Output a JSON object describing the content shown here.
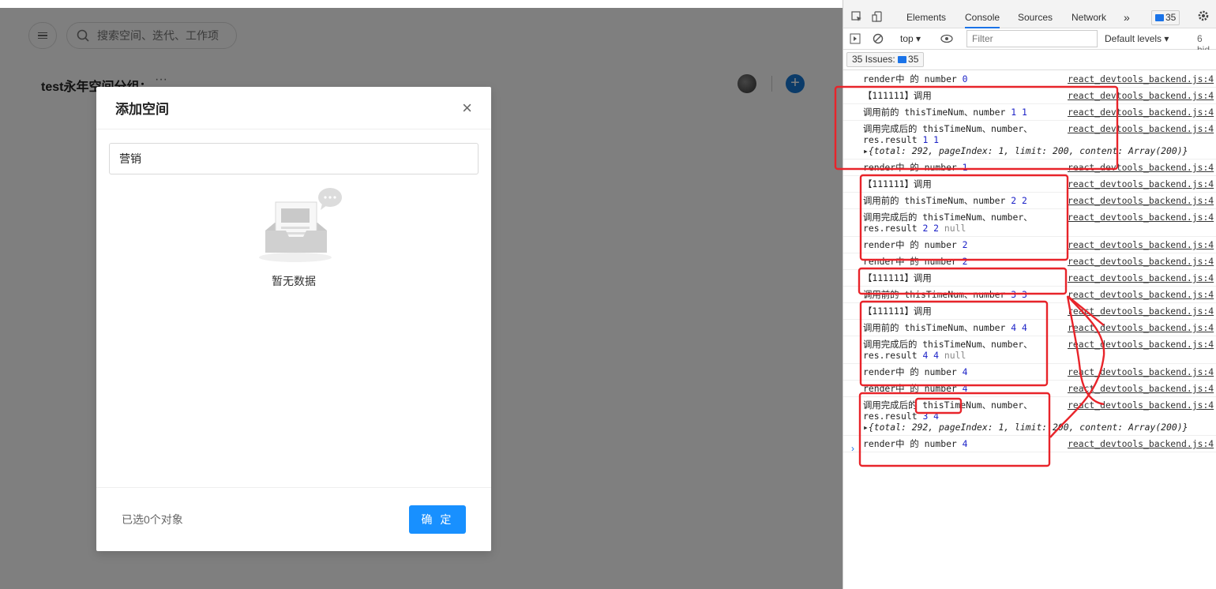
{
  "app": {
    "search_placeholder": "搜索空间、迭代、工作项",
    "space_group_title": "test永年空间分组",
    "more_label": "···"
  },
  "modal": {
    "title": "添加空间",
    "close_glyph": "×",
    "search_value": "营销",
    "empty_text": "暂无数据",
    "selected_count": "已选0个对象",
    "confirm_label": "确 定"
  },
  "devtools": {
    "tabs": [
      "Elements",
      "Console",
      "Sources",
      "Network"
    ],
    "active_tab": "Console",
    "more_tabs": "»",
    "issue_badge_count": "35",
    "context": "top ▾",
    "filter_placeholder": "Filter",
    "levels": "Default levels ▾",
    "hidden": "6 hid",
    "issues_label": "35 Issues:",
    "issues_count": "35",
    "logs": [
      {
        "msg": "render中 的 number ",
        "nums": "0",
        "src": "react_devtools_backend.js:4"
      },
      {
        "msg": "【111111】调用",
        "nums": "",
        "src": "react_devtools_backend.js:4"
      },
      {
        "msg": "调用前的 thisTimeNum、number ",
        "nums": "1 1",
        "src": "react_devtools_backend.js:4"
      },
      {
        "msg": "调用完成后的 thisTimeNum、number、\nres.result ",
        "nums": "1 1",
        "src": "react_devtools_backend.js:4",
        "obj": "{total: 292, pageIndex: 1, limit: 200, content: Array(200)}"
      },
      {
        "msg": "render中 的 number ",
        "nums": "1",
        "src": "react_devtools_backend.js:4"
      },
      {
        "msg": "【111111】调用",
        "nums": "",
        "src": "react_devtools_backend.js:4"
      },
      {
        "msg": "调用前的 thisTimeNum、number ",
        "nums": "2 2",
        "src": "react_devtools_backend.js:4"
      },
      {
        "msg": "调用完成后的 thisTimeNum、number、\nres.result ",
        "nums": "2 2",
        "null": " null",
        "src": "react_devtools_backend.js:4"
      },
      {
        "msg": "render中 的 number ",
        "nums": "2",
        "src": "react_devtools_backend.js:4"
      },
      {
        "msg": "render中 的 number ",
        "nums": "2",
        "src": "react_devtools_backend.js:4"
      },
      {
        "msg": "【111111】调用",
        "nums": "",
        "src": "react_devtools_backend.js:4"
      },
      {
        "msg": "调用前的 thisTimeNum、number ",
        "nums": "3 3",
        "src": "react_devtools_backend.js:4"
      },
      {
        "msg": "【111111】调用",
        "nums": "",
        "src": "react_devtools_backend.js:4"
      },
      {
        "msg": "调用前的 thisTimeNum、number ",
        "nums": "4 4",
        "src": "react_devtools_backend.js:4"
      },
      {
        "msg": "调用完成后的 thisTimeNum、number、\nres.result ",
        "nums": "4 4",
        "null": " null",
        "src": "react_devtools_backend.js:4"
      },
      {
        "msg": "render中 的 number ",
        "nums": "4",
        "src": "react_devtools_backend.js:4"
      },
      {
        "msg": "render中 的 number ",
        "nums": "4",
        "src": "react_devtools_backend.js:4"
      },
      {
        "msg": "调用完成后的 thisTimeNum、number、\nres.result ",
        "nums": "3 4",
        "src": "react_devtools_backend.js:4",
        "obj": "{total: 292, pageIndex: 1, limit: 200, content: Array(200)}"
      },
      {
        "msg": "render中 的 number ",
        "nums": "4",
        "src": "react_devtools_backend.js:4"
      }
    ],
    "prompt": "›"
  },
  "colors": {
    "accent": "#1890ff",
    "annotation": "#e8242a",
    "console_number": "#1c22c7"
  }
}
